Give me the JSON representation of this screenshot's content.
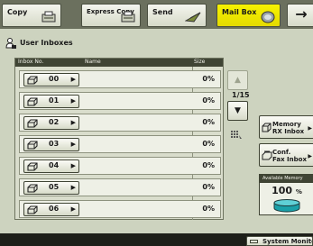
{
  "tabs": [
    {
      "label": "Copy",
      "icon": "copy-icon",
      "active": false
    },
    {
      "label": "Express Copy",
      "icon": "express-copy-icon",
      "active": false
    },
    {
      "label": "Send",
      "icon": "send-icon",
      "active": false
    },
    {
      "label": "Mail Box",
      "icon": "mailbox-icon",
      "active": true
    }
  ],
  "next_tab_arrow": "→",
  "title": "User Inboxes",
  "list": {
    "headers": {
      "inbox_no": "Inbox No.",
      "name": "Name",
      "size": "Size"
    },
    "rows": [
      {
        "number": "00",
        "name": "",
        "size": "0%"
      },
      {
        "number": "01",
        "name": "",
        "size": "0%"
      },
      {
        "number": "02",
        "name": "",
        "size": "0%"
      },
      {
        "number": "03",
        "name": "",
        "size": "0%"
      },
      {
        "number": "04",
        "name": "",
        "size": "0%"
      },
      {
        "number": "05",
        "name": "",
        "size": "0%"
      },
      {
        "number": "06",
        "name": "",
        "size": "0%"
      }
    ]
  },
  "pagination": {
    "page_indicator": "1/15",
    "up": "▲",
    "down": "▼"
  },
  "side_buttons": {
    "memory_rx": "Memory\nRX Inbox",
    "conf_fax": "Conf.\nFax Inbox"
  },
  "memory": {
    "label": "Available Memory",
    "value": "100",
    "unit": "%"
  },
  "system_monitor": "System Monitor",
  "colors": {
    "active_tab": "#e8e000",
    "background": "#cdd3bf",
    "header_bar": "#3f4434"
  }
}
